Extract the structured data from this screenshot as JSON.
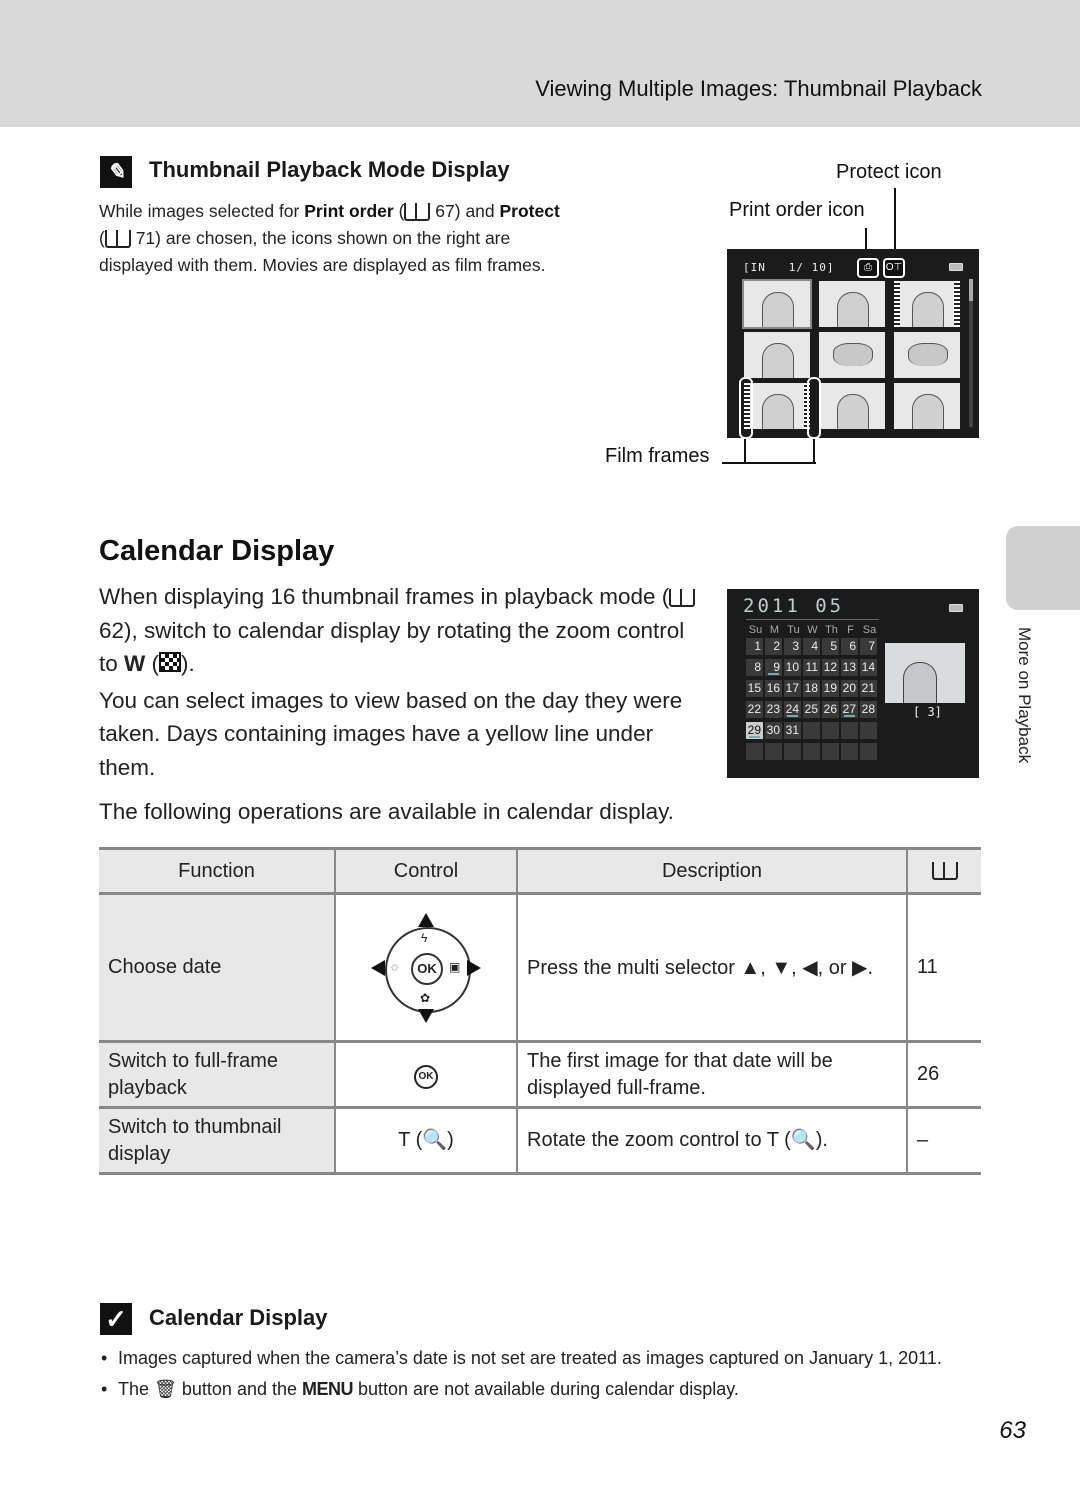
{
  "running_head": "Viewing Multiple Images: Thumbnail Playback",
  "note": {
    "icon": "pencil-note-icon",
    "title": "Thumbnail Playback Mode Display",
    "p1_pre": "While images selected for ",
    "print_order": "Print order",
    "p1_ref1": " (",
    "page_ref1": "67",
    "p1_mid": ") and ",
    "protect": "Protect",
    "p1_ref2": " (",
    "page_ref2": "71",
    "p1_post": ") are chosen, the icons shown on the right are displayed with them. Movies are displayed as film frames."
  },
  "callouts": {
    "protect_icon": "Protect icon",
    "print_order_icon": "Print order icon",
    "film_frames": "Film frames"
  },
  "thumb_screen": {
    "memory": "[IN",
    "counter": "1/   10]",
    "print_glyph": "⎙",
    "protect_glyph": "O⊤",
    "thumbnails": [
      {
        "type": "portrait",
        "selected": true,
        "film": false
      },
      {
        "type": "portrait",
        "selected": false,
        "film": false
      },
      {
        "type": "portrait",
        "selected": false,
        "film": true
      },
      {
        "type": "portrait",
        "selected": false,
        "film": false
      },
      {
        "type": "flower",
        "selected": false,
        "film": false
      },
      {
        "type": "flower",
        "selected": false,
        "film": false
      },
      {
        "type": "portrait",
        "selected": false,
        "film": true
      },
      {
        "type": "portrait",
        "selected": false,
        "film": false
      },
      {
        "type": "portrait",
        "selected": false,
        "film": false
      }
    ]
  },
  "calendar_section": {
    "title": "Calendar Display",
    "p1_a": "When displaying 16 thumbnail frames in playback mode (",
    "p1_ref": "62",
    "p1_b": "), switch to calendar display by rotating the zoom control to ",
    "p1_w": "W",
    "p1_c": " (",
    "p1_d": ").",
    "p2": "You can select images to view based on the day they were taken. Days containing images have a yellow line under them.",
    "ops_intro": "The following operations are available in calendar display."
  },
  "calendar_screen": {
    "year_month": "2011  05",
    "weekdays": [
      "Su",
      "M",
      "Tu",
      "W",
      "Th",
      "F",
      "Sa"
    ],
    "days": [
      "1",
      "2",
      "3",
      "4",
      "5",
      "6",
      "7",
      "8",
      "9",
      "10",
      "11",
      "12",
      "13",
      "14",
      "15",
      "16",
      "17",
      "18",
      "19",
      "20",
      "21",
      "22",
      "23",
      "24",
      "25",
      "26",
      "27",
      "28",
      "29",
      "30",
      "31"
    ],
    "days_with_images": [
      "9",
      "24",
      "27",
      "29"
    ],
    "selected_day": "29",
    "image_count": "[     3]"
  },
  "side_tab": {
    "label": "More on Playback"
  },
  "table": {
    "headers": [
      "Function",
      "Control",
      "Description"
    ],
    "rows": [
      {
        "function": "Choose date",
        "control": "multi-selector",
        "description": "Press the multi selector ▲, ▼, ◀, or ▶.",
        "page": "11"
      },
      {
        "function": "Switch to full-frame playback",
        "control": "OK",
        "description": "The first image for that date will be displayed full-frame.",
        "page": "26"
      },
      {
        "function": "Switch to thumbnail display",
        "control": "T (🔍)",
        "description": "Rotate the zoom control to T (🔍).",
        "page": "–"
      }
    ],
    "dpad": {
      "ok": "OK",
      "up": "ϟ",
      "left": "◌",
      "right": "▣",
      "down": "✿"
    }
  },
  "tip": {
    "title": "Calendar Display",
    "items": [
      "Images captured when the camera’s date is not set are treated as images captured on January 1, 2011.",
      {
        "pre": "The ",
        "trash": "🗑",
        "mid": " button and the ",
        "menu": "MENU",
        "post": " button are not available during calendar display."
      }
    ]
  },
  "page_number": "63"
}
